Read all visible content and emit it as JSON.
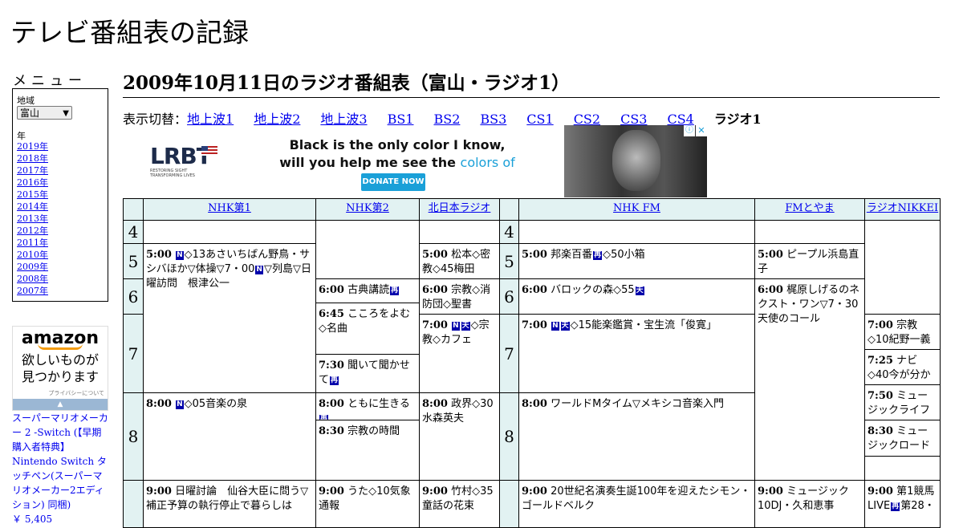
{
  "site_title": "テレビ番組表の記録",
  "sidebar": {
    "menu_heading": "メニュー",
    "region_label": "地域",
    "region_value": "富山",
    "year_label": "年",
    "years": [
      "2019年",
      "2018年",
      "2017年",
      "2016年",
      "2015年",
      "2014年",
      "2013年",
      "2012年",
      "2011年",
      "2010年",
      "2009年",
      "2008年",
      "2007年"
    ],
    "amazon_logo": "amazon",
    "amazon_msg_1": "欲しいものが",
    "amazon_msg_2": "見つかります",
    "amazon_privacy": "プライバシーについて",
    "product_title": "スーパーマリオメーカー 2 -Switch (【早期購入者特典】Nintendo Switch タッチペン(スーパーマリオメーカー2エディション) 同梱)",
    "product_price": "￥ 5,405"
  },
  "main": {
    "page_title": "2009年10月11日のラジオ番組表（富山・ラジオ1）",
    "switch_label": "表示切替：",
    "switch_links": [
      "地上波1",
      "地上波2",
      "地上波3",
      "BS1",
      "BS2",
      "BS3",
      "CS1",
      "CS2",
      "CS3",
      "CS4"
    ],
    "switch_current": "ラジオ1"
  },
  "ad": {
    "brand": "LRBT",
    "brand_sub": "RESTORING SIGHT TRANSFORMING LIVES",
    "line1": "Black is the only color I know,",
    "line2_a": "will you help me see the ",
    "line2_b": "colors of life?",
    "button": "DONATE NOW"
  },
  "schedule": {
    "channels": [
      "NHK第1",
      "NHK第2",
      "北日本ラジオ",
      "NHK FM",
      "FMとやま",
      "ラジオNIKKEI"
    ],
    "hours": [
      "4",
      "5",
      "6",
      "7",
      "8"
    ],
    "programs": {
      "nhk1_500_time": "5:00",
      "nhk1_500_title": "◇13あさいちばん野鳥・サシバほか▽体操▽7・00",
      "nhk1_500_title2": "▽列島▽日曜訪問　根津公一",
      "nhk1_800_time": "8:00",
      "nhk1_800_title": "◇05音楽の泉",
      "nhk1_900_time": "9:00",
      "nhk1_900_title": "日曜討論　仙谷大臣に問う▽補正予算の執行停止で暮らしは",
      "nhk2_600_time": "6:00",
      "nhk2_600_title": "古典講読",
      "nhk2_645_time": "6:45",
      "nhk2_645_title": "こころをよむ◇名曲",
      "nhk2_730_time": "7:30",
      "nhk2_730_title": "聞いて聞かせて",
      "nhk2_800_time": "8:00",
      "nhk2_800_title": "ともに生きる",
      "nhk2_830_time": "8:30",
      "nhk2_830_title": "宗教の時間",
      "nhk2_900_time": "9:00",
      "nhk2_900_title": "うた◇10気象通報",
      "knb_500_time": "5:00",
      "knb_500_title": "松本◇密教◇45梅田",
      "knb_600_time": "6:00",
      "knb_600_title": "宗教◇消防団◇聖書",
      "knb_700_time": "7:00",
      "knb_700_title": "◇宗教◇カフェ",
      "knb_800_time": "8:00",
      "knb_800_title": "政界◇30水森英夫",
      "knb_900_time": "9:00",
      "knb_900_title": "竹村◇35童話の花束",
      "fm_500_time": "5:00",
      "fm_500_title": "邦楽百番",
      "fm_500_title2": "◇50小箱",
      "fm_600_time": "6:00",
      "fm_600_title": "バロックの森◇55",
      "fm_700_time": "7:00",
      "fm_700_title": "◇15能楽鑑賞・宝生流「俊寛」",
      "fm_800_time": "8:00",
      "fm_800_title": "ワールドMタイム▽メキシコ音楽入門",
      "fm_900_time": "9:00",
      "fm_900_title": "20世紀名演奏生誕100年を迎えたシモン・ゴールドベルク",
      "fmt_500_time": "5:00",
      "fmt_500_title": "ピープル浜島直子",
      "fmt_600_time": "6:00",
      "fmt_600_title": "梶原しげるのネクスト・ワン▽7・30天使のコール",
      "fmt_900_time": "9:00",
      "fmt_900_title": "ミュージック10DJ・久和恵事",
      "nikkei_700_time": "7:00",
      "nikkei_700_title": "宗教◇10紀野一義",
      "nikkei_725_time": "7:25",
      "nikkei_725_title": "ナビ◇40今が分かる",
      "nikkei_750_time": "7:50",
      "nikkei_750_title": "ミュージックライフ",
      "nikkei_830_time": "8:30",
      "nikkei_830_title": "ミュージックロード",
      "nikkei_900_time": "9:00",
      "nikkei_900_title": "第1競馬LIVE",
      "nikkei_900_title2": "第28・"
    },
    "badges": {
      "N": "N",
      "ten": "天",
      "sai": "再"
    }
  },
  "colors": {
    "header_bg": "#e2f2f2",
    "link": "#0000ee",
    "badge": "#0000aa"
  }
}
